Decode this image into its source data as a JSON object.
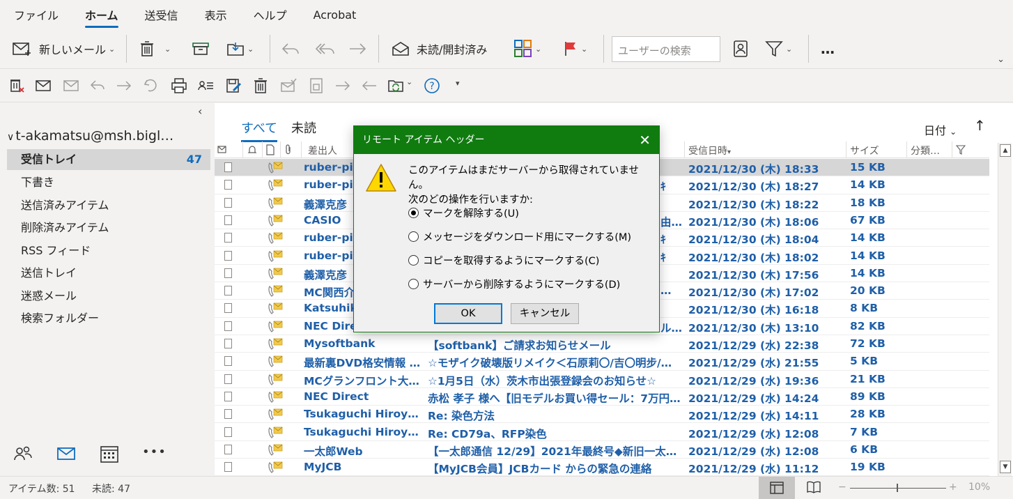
{
  "menu": [
    "ファイル",
    "ホーム",
    "送受信",
    "表示",
    "ヘルプ",
    "Acrobat"
  ],
  "ribbon": {
    "new_mail": "新しいメール",
    "unread_read": "未読/開封済み",
    "search_placeholder": "ユーザーの検索",
    "more": "…"
  },
  "folder_pane": {
    "account": "t-akamatsu@msh.bigl…",
    "folders": [
      {
        "name": "受信トレイ",
        "count": "47",
        "selected": true
      },
      {
        "name": "下書き",
        "count": ""
      },
      {
        "name": "送信済みアイテム",
        "count": ""
      },
      {
        "name": "削除済みアイテム",
        "count": ""
      },
      {
        "name": "RSS フィード",
        "count": ""
      },
      {
        "name": "送信トレイ",
        "count": ""
      },
      {
        "name": "迷惑メール",
        "count": ""
      },
      {
        "name": "検索フォルダー",
        "count": ""
      }
    ],
    "nav_more": "•••"
  },
  "mail_list": {
    "tabs": [
      "すべて",
      "未読"
    ],
    "sort_label": "日付",
    "columns": [
      "差出人",
      "受信日時",
      "サイズ",
      "分類…"
    ],
    "rows": [
      {
        "from": "ruber-pi",
        "subject": "",
        "date": "2021/12/30 (木) 18:33",
        "size": "15 KB"
      },
      {
        "from": "ruber-pi",
        "subject": "",
        "date": "2021/12/30 (木) 18:27",
        "size": "14 KB"
      },
      {
        "from": "義澤克彦",
        "subject": "",
        "date": "2021/12/30 (木) 18:22",
        "size": "18 KB"
      },
      {
        "from": "CASIO",
        "subject": "",
        "date": "2021/12/30 (木) 18:06",
        "size": "67 KB"
      },
      {
        "from": "ruber-pi",
        "subject": "",
        "date": "2021/12/30 (木) 18:04",
        "size": "14 KB"
      },
      {
        "from": "ruber-pi",
        "subject": "",
        "date": "2021/12/30 (木) 18:02",
        "size": "14 KB"
      },
      {
        "from": "義澤克彦",
        "subject": "",
        "date": "2021/12/30 (木) 17:56",
        "size": "14 KB"
      },
      {
        "from": "MC関西介",
        "subject": "",
        "date": "2021/12/30 (木) 17:02",
        "size": "20 KB"
      },
      {
        "from": "Katsuhik",
        "subject": "",
        "date": "2021/12/30 (木) 16:18",
        "size": "8 KB"
      },
      {
        "from": "NEC Direc",
        "subject": "",
        "date": "2021/12/30 (木) 13:10",
        "size": "82 KB"
      },
      {
        "from": "Mysoftbank",
        "subject": "【softbank】ご請求お知らせメール",
        "date": "2021/12/29 (水) 22:38",
        "size": "72 KB"
      },
      {
        "from": "最新裏DVD格安情報 …",
        "subject": "☆モザイク破壊版リメイク＜石原莉〇/吉〇明步/…",
        "date": "2021/12/29 (水) 21:55",
        "size": "5 KB"
      },
      {
        "from": "MCグランフロント大阪…",
        "subject": "☆1月5日（水）茨木市出張登録会のお知らせ☆",
        "date": "2021/12/29 (水) 19:36",
        "size": "21 KB"
      },
      {
        "from": "NEC Direct",
        "subject": "赤松 孝子 様へ【旧モデルお買い得セール：7万円台…",
        "date": "2021/12/29 (水) 14:24",
        "size": "89 KB"
      },
      {
        "from": "Tsukaguchi Hiroya…",
        "subject": "Re: 染色方法",
        "date": "2021/12/29 (水) 14:11",
        "size": "28 KB"
      },
      {
        "from": "Tsukaguchi Hiroya…",
        "subject": "Re: CD79a、RFP染色",
        "date": "2021/12/29 (水) 12:08",
        "size": "7 KB"
      },
      {
        "from": "一太郎Web",
        "subject": "【一太郎通信 12/29】2021年最終号◆新旧一太…",
        "date": "2021/12/29 (水) 12:08",
        "size": "6 KB"
      },
      {
        "from": "MyJCB",
        "subject": "【MyJCB会員】JCBカード からの緊急の連絡",
        "date": "2021/12/29 (水) 11:12",
        "size": "19 KB"
      }
    ],
    "partial_subjects": [
      "",
      "ｷ",
      "",
      "由…",
      "ｷ",
      "ｷ",
      "",
      "…",
      "",
      "ル…"
    ]
  },
  "status": {
    "items": "アイテム数: 51",
    "unread": "未読: 47",
    "zoom": "10%",
    "zoom_minus": "−",
    "zoom_plus": "+"
  },
  "dialog": {
    "title": "リモート アイテム ヘッダー",
    "close": "✕",
    "message_line1": "このアイテムはまだサーバーから取得されていません。",
    "message_line2": "次のどの操作を行いますか:",
    "options": [
      {
        "label": "マークを解除する(U)",
        "selected": true
      },
      {
        "label": "メッセージをダウンロード用にマークする(M)",
        "selected": false
      },
      {
        "label": "コピーを取得するようにマークする(C)",
        "selected": false
      },
      {
        "label": "サーバーから削除するようにマークする(D)",
        "selected": false
      }
    ],
    "ok": "OK",
    "cancel": "キャンセル"
  },
  "colors": {
    "accent": "#0f6cbd",
    "dialog_title": "#107c10",
    "unread_text": "#1f5fa8"
  }
}
